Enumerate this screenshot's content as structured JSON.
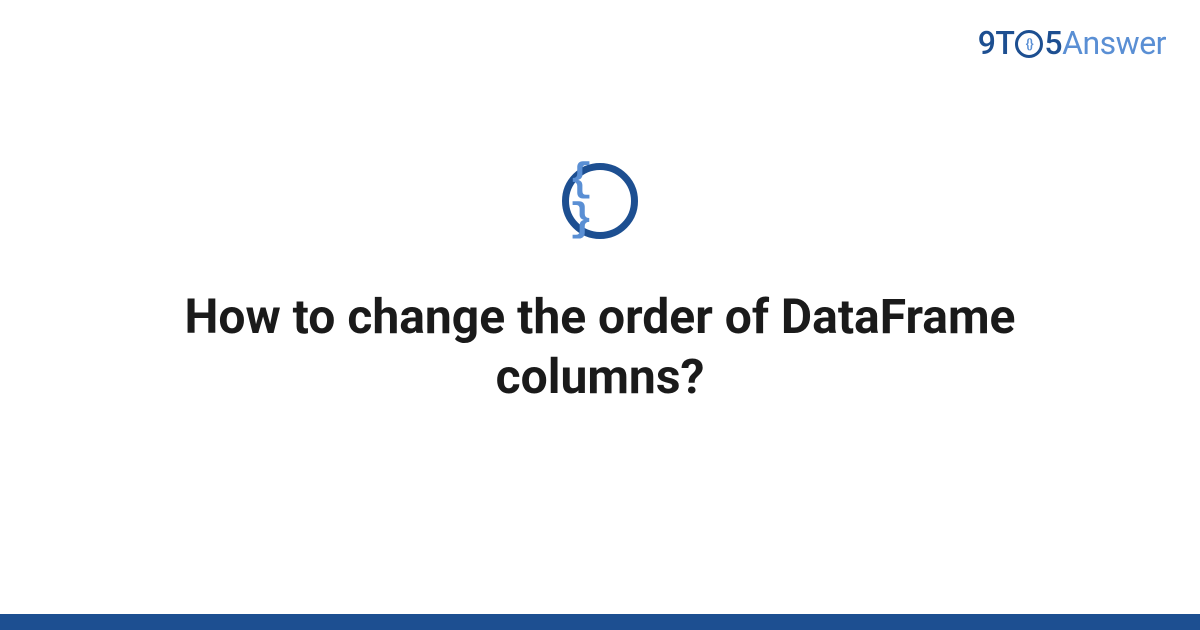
{
  "logo": {
    "part1": "9T",
    "part_o_inner": "{}",
    "part2": "5",
    "part3": "Answer"
  },
  "icon": {
    "braces": "{ }"
  },
  "title": "How to change the order of DataFrame columns?"
}
